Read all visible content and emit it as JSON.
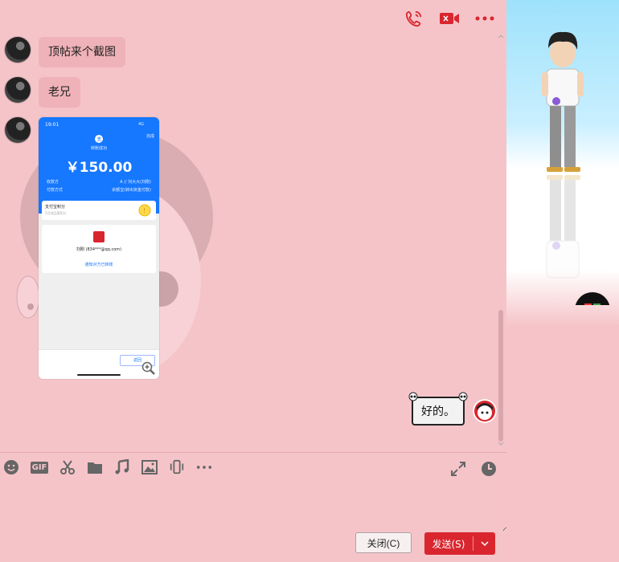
{
  "messages": [
    {
      "type": "text",
      "text": "顶帖来个截图"
    },
    {
      "type": "text",
      "text": "老兄"
    },
    {
      "type": "image"
    }
  ],
  "screenshot": {
    "time": "19:01",
    "signal": "4G",
    "title": "转账成功",
    "done": "完成",
    "amount": "￥150.00",
    "payee_label": "收款方",
    "payee_value": "A // 刘大大(刘刚)",
    "method_label": "付款方式",
    "method_value": "余额宝(转出资金付款)",
    "points_title": "支付宝积分",
    "points_sub": "5月领品莫积分",
    "contact_name": "刘刚 (834***@qq.com)",
    "notify_link": "通知对方已转账",
    "back_btn": "返回"
  },
  "own_message": {
    "text": "好的。"
  },
  "toolbar": {
    "gif_label": "GIF"
  },
  "buttons": {
    "close_label": "关闭(C)",
    "send_label": "发送(S)"
  },
  "colors": {
    "accent": "#d9262e",
    "chat_bg": "#f5c4c9",
    "bubble": "#efb2b8"
  }
}
